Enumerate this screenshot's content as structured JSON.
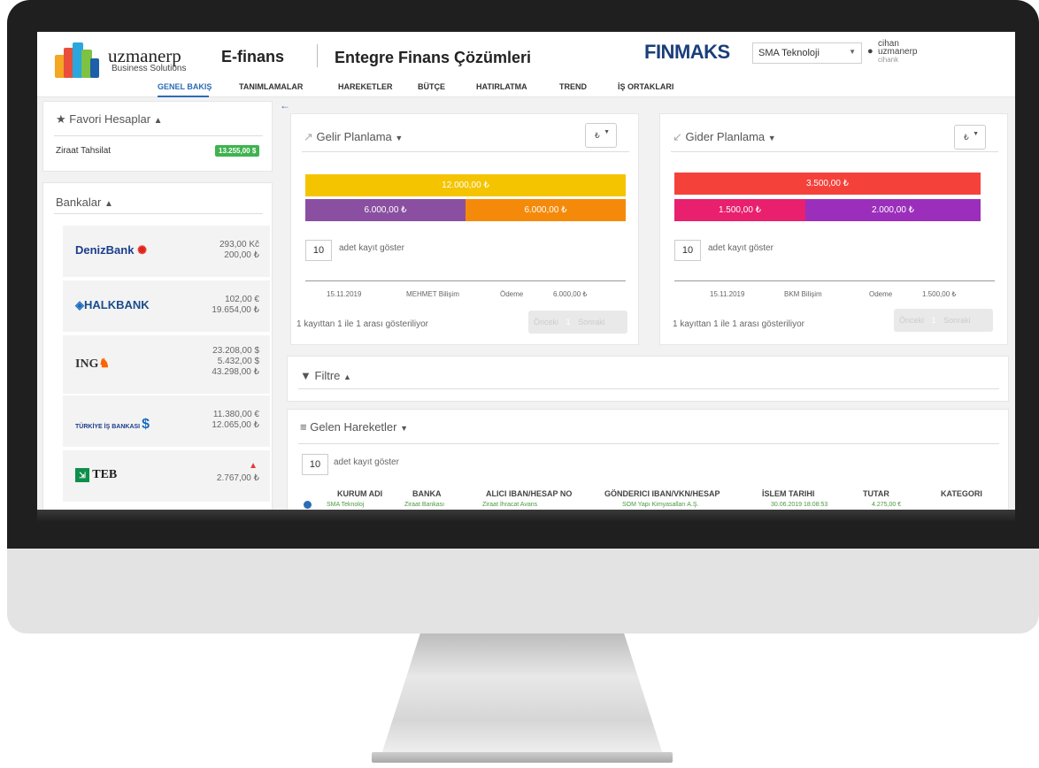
{
  "app": {
    "brand": "uzmanerp",
    "brand_sub": "Business Solutions",
    "module": "E-finans",
    "tagline": "Entegre Finans Çözümleri",
    "product_logo": "FINMAKS"
  },
  "header": {
    "company_select": "SMA Teknoloji",
    "user_first": "cihan",
    "user_last": "uzmanerp",
    "user_handle": "cihank"
  },
  "nav": {
    "items": [
      "GENEL BAKIŞ",
      "TANIMLAMALAR",
      "HAREKETLER",
      "BÜTÇE",
      "HATIRLATMA",
      "TREND",
      "İŞ ORTAKLARI"
    ],
    "active": "GENEL BAKIŞ"
  },
  "favorites": {
    "title": "Favori Hesaplar",
    "items": [
      {
        "name": "Ziraat Tahsilat",
        "badge": "13.255,00 $"
      }
    ]
  },
  "banks": {
    "title": "Bankalar",
    "items": [
      {
        "name": "DenizBank",
        "amounts": [
          "293,00 Kč",
          "200,00 ₺"
        ]
      },
      {
        "name": "HALKBANK",
        "amounts": [
          "102,00 €",
          "19.654,00 ₺"
        ]
      },
      {
        "name": "ING",
        "amounts": [
          "23.208,00 $",
          "5.432,00 $",
          "43.298,00 ₺"
        ]
      },
      {
        "name": "TÜRKİYE İŞ BANKASI",
        "amounts": [
          "11.380,00 €",
          "12.065,00 ₺"
        ]
      },
      {
        "name": "TEB",
        "amounts": [
          "2.767,00 ₺"
        ],
        "warning": true
      }
    ]
  },
  "income": {
    "title": "Gelir Planlama",
    "currency": "₺",
    "total_bar": "12.000,00 ₺",
    "split_bars": [
      "6.000,00 ₺",
      "6.000,00 ₺"
    ],
    "page_size": "10",
    "page_size_label": "adet kayıt göster",
    "row": {
      "date": "15.11.2019",
      "company": "MEHMET Bilişim",
      "type": "Ödeme",
      "amount": "6.000,00 ₺"
    },
    "info": "1 kayıttan 1 ile 1 arası gösteriliyor",
    "pager": {
      "prev": "Önceki",
      "page": "1",
      "next": "Sonraki"
    }
  },
  "expense": {
    "title": "Gider Planlama",
    "currency": "₺",
    "total_bar": "3.500,00 ₺",
    "split_bars": [
      "1.500,00 ₺",
      "2.000,00 ₺"
    ],
    "page_size": "10",
    "page_size_label": "adet kayıt göster",
    "row": {
      "date": "15.11.2019",
      "company": "BKM Bilişim",
      "type": "Odeme",
      "amount": "1.500,00 ₺"
    },
    "info": "1 kayıttan 1 ile 1 arası gösteriliyor",
    "pager": {
      "prev": "Önceki",
      "page": "1",
      "next": "Sonraki"
    }
  },
  "filter": {
    "title": "Filtre"
  },
  "incoming": {
    "title": "Gelen Hareketler",
    "page_size": "10",
    "page_size_label": "adet kayıt göster",
    "columns": [
      "KURUM ADI",
      "BANKA",
      "ALICI IBAN/HESAP NO",
      "GÖNDERICI IBAN/VKN/HESAP",
      "İSLEM TARIHI",
      "TUTAR",
      "KATEGORI"
    ],
    "rows": [
      [
        "SMA Teknoloj",
        "Ziraat Bankası",
        "Ziraat İhracat Avans",
        "SOM Yapı Kimyasalları A.Ş.",
        "30.06.2019 18:08:53",
        "4.275,00 €",
        ""
      ]
    ]
  },
  "colors": {
    "accent": "#2b6cb5",
    "income_total": "#f5c400",
    "income_a": "#8a4fa0",
    "income_b": "#f58a0a",
    "expense_total": "#f4423b",
    "expense_a": "#e8206d",
    "expense_b": "#9b2fbb",
    "badge": "#3fb34f"
  }
}
